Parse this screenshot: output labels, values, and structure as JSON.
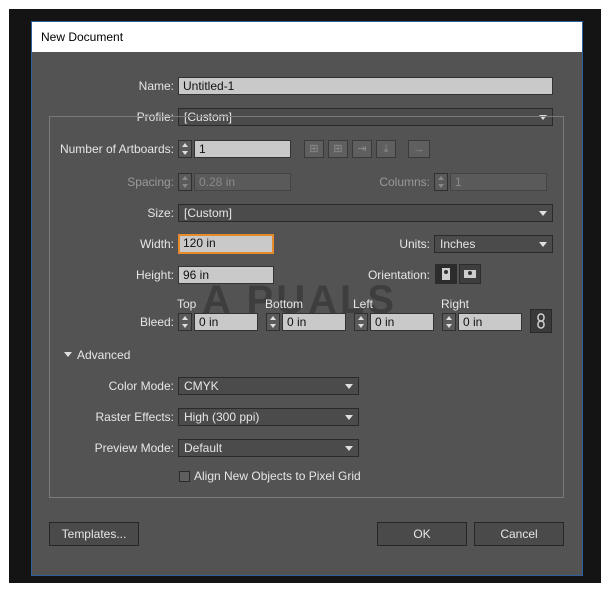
{
  "window": {
    "title": "New Document"
  },
  "name": {
    "label": "Name:",
    "value": "Untitled-1"
  },
  "profile": {
    "label": "Profile:",
    "value": "[Custom]"
  },
  "artboards": {
    "label": "Number of Artboards:",
    "value": "1",
    "arrange_icons": [
      "grid-by-row-icon",
      "grid-by-column-icon",
      "arrange-by-row-icon",
      "arrange-by-column-icon",
      "right-to-left-icon"
    ]
  },
  "spacing": {
    "label": "Spacing:",
    "value": "0.28 in"
  },
  "columns": {
    "label": "Columns:",
    "value": "1"
  },
  "size": {
    "label": "Size:",
    "value": "[Custom]"
  },
  "width": {
    "label": "Width:",
    "value": "120 in"
  },
  "units": {
    "label": "Units:",
    "value": "Inches"
  },
  "height": {
    "label": "Height:",
    "value": "96 in"
  },
  "orientation": {
    "label": "Orientation:",
    "selected": "portrait"
  },
  "bleed": {
    "label": "Bleed:",
    "top_label": "Top",
    "top_value": "0 in",
    "bottom_label": "Bottom",
    "bottom_value": "0 in",
    "left_label": "Left",
    "left_value": "0 in",
    "right_label": "Right",
    "right_value": "0 in"
  },
  "advanced": {
    "label": "Advanced",
    "color_mode": {
      "label": "Color Mode:",
      "value": "CMYK"
    },
    "raster_effects": {
      "label": "Raster Effects:",
      "value": "High (300 ppi)"
    },
    "preview_mode": {
      "label": "Preview Mode:",
      "value": "Default"
    },
    "align_pixel_grid": {
      "label": "Align New Objects to Pixel Grid",
      "checked": false
    }
  },
  "buttons": {
    "templates": "Templates...",
    "ok": "OK",
    "cancel": "Cancel"
  },
  "watermark": {
    "text": "A  PUALS"
  },
  "colors": {
    "dialog_bg": "#535353",
    "focus_accent": "#e58a2d",
    "window_border": "#2d5f9e"
  }
}
